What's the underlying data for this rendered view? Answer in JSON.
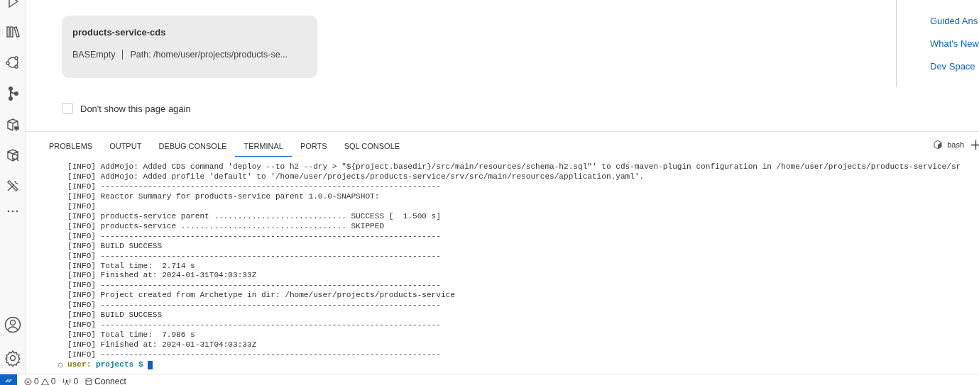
{
  "activity_bar": [
    {
      "kind": "run"
    },
    {
      "kind": "library"
    },
    {
      "kind": "nodes"
    },
    {
      "kind": "git"
    },
    {
      "kind": "plugin"
    },
    {
      "kind": "inspect"
    },
    {
      "kind": "tools"
    },
    {
      "kind": "more"
    }
  ],
  "activity_bottom": [
    {
      "kind": "account"
    },
    {
      "kind": "settings"
    }
  ],
  "project_card": {
    "title": "products-service-cds",
    "template": "BASEmpty",
    "path": "Path: /home/user/projects/products-se..."
  },
  "dont_show_again": {
    "label": "Don't show this page again",
    "checked": false
  },
  "side_links": [
    "Guided Ans",
    "What's New",
    "Dev Space"
  ],
  "panel_tabs": [
    {
      "label": "PROBLEMS",
      "selected": false
    },
    {
      "label": "OUTPUT",
      "selected": false
    },
    {
      "label": "DEBUG CONSOLE",
      "selected": false
    },
    {
      "label": "TERMINAL",
      "selected": true
    },
    {
      "label": "PORTS",
      "selected": false
    },
    {
      "label": "SQL CONSOLE",
      "selected": false
    }
  ],
  "terminal_name": "bash",
  "terminal_lines": [
    "[INFO] AddMojo: Added CDS command 'deploy --to h2 --dry > \"${project.basedir}/src/main/resources/schema-h2.sql\"' to cds-maven-plugin configuration in /home/user/projects/products-service/sr",
    "[INFO] AddMojo: Added profile 'default' to '/home/user/projects/products-service/srv/src/main/resources/application.yaml'.",
    "[INFO] ------------------------------------------------------------------------",
    "[INFO] Reactor Summary for products-service parent 1.0.0-SNAPSHOT:",
    "[INFO]",
    "[INFO] products-service parent ............................ SUCCESS [  1.500 s]",
    "[INFO] products-service ................................... SKIPPED",
    "[INFO] ------------------------------------------------------------------------",
    "[INFO] BUILD SUCCESS",
    "[INFO] ------------------------------------------------------------------------",
    "[INFO] Total time:  2.714 s",
    "[INFO] Finished at: 2024-01-31T04:03:33Z",
    "[INFO] ------------------------------------------------------------------------",
    "[INFO] Project created from Archetype in dir: /home/user/projects/products-service",
    "[INFO] ------------------------------------------------------------------------",
    "[INFO] BUILD SUCCESS",
    "[INFO] ------------------------------------------------------------------------",
    "[INFO] Total time:  7.986 s",
    "[INFO] Finished at: 2024-01-31T04:03:33Z",
    "[INFO] ------------------------------------------------------------------------"
  ],
  "prompt": {
    "user": "user:",
    "dir": "projects $"
  },
  "status_bar": {
    "errors": "0",
    "warnings": "0",
    "ports": "0",
    "connect": "Connect"
  }
}
